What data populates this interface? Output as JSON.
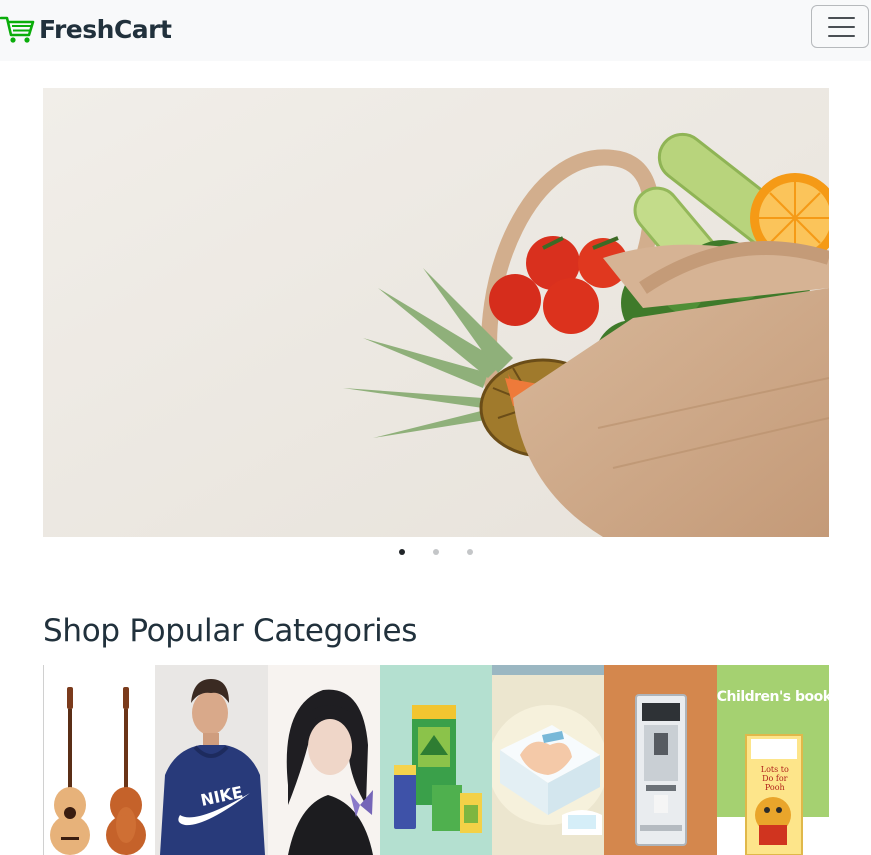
{
  "navbar": {
    "brand": "FreshCart",
    "menu_button_label": "Toggle navigation",
    "brand_color": "#0aad0a",
    "background": "#f8f9fa"
  },
  "hero_slider": {
    "active_index": 0,
    "slide_count": 3,
    "indicator_active_color": "#212529",
    "indicator_inactive_color": "#c4c6c8"
  },
  "categories_section": {
    "title": "Shop Popular Categories",
    "items": [
      {
        "icon": "guitar-image"
      },
      {
        "icon": "hoodie-image"
      },
      {
        "icon": "portrait-image"
      },
      {
        "icon": "grocery-image"
      },
      {
        "icon": "baby-care-image"
      },
      {
        "icon": "coffee-machine-image"
      },
      {
        "icon": "childrens-books-image",
        "overlay_text": "Children's books",
        "book_title": "Lots to Do for Pooh"
      }
    ]
  }
}
